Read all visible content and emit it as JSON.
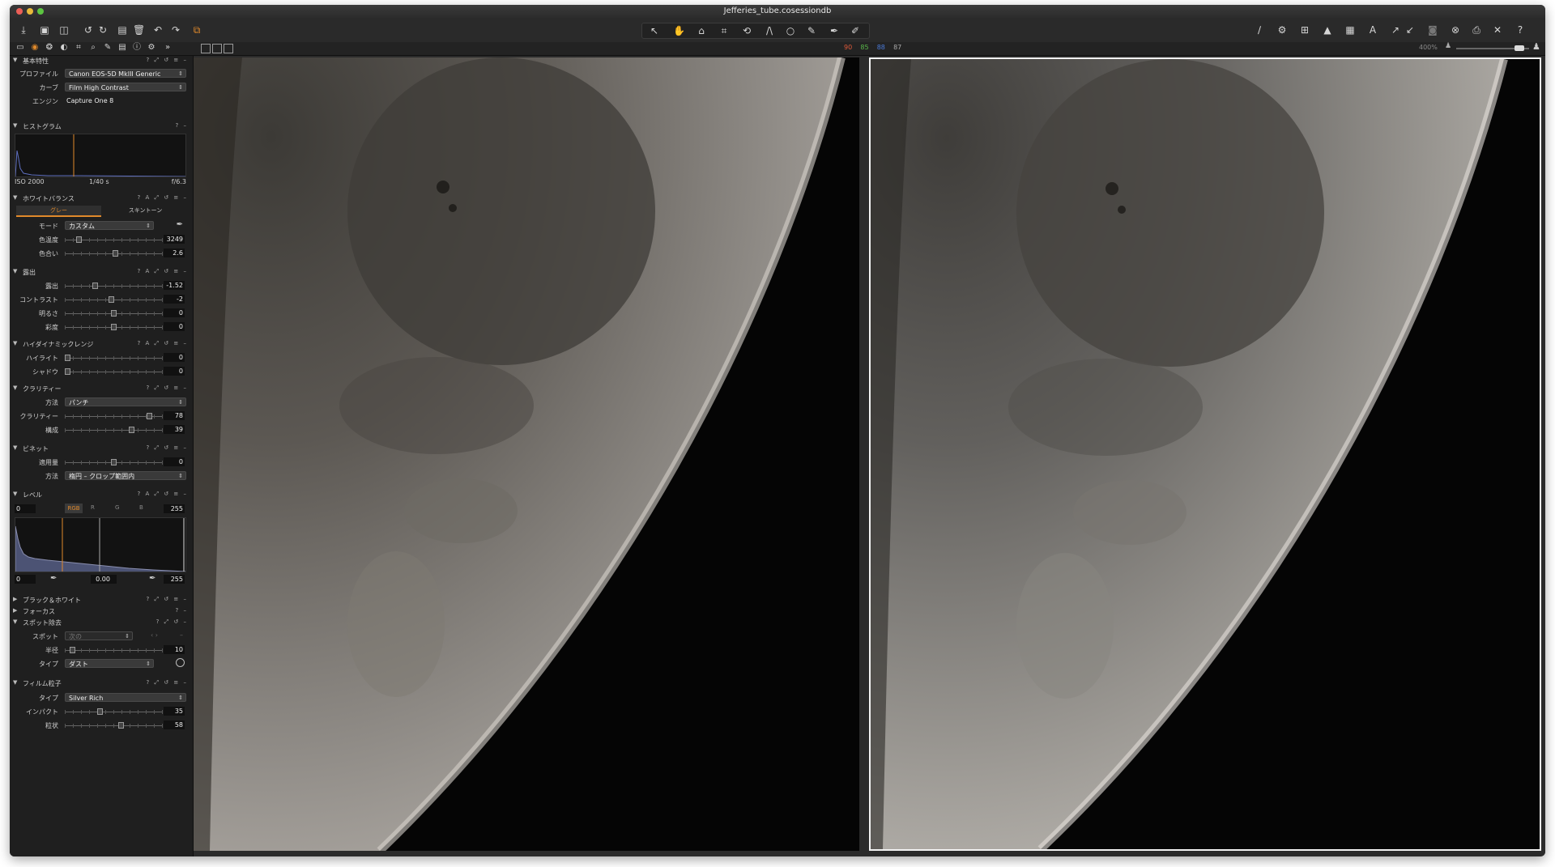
{
  "window": {
    "title": "Jefferies_tube.cosessiondb"
  },
  "colors": {
    "accent": "#e0892b",
    "panel_bg": "#1f1f1f",
    "view_bg": "#050505"
  },
  "subbar": {
    "readout": {
      "r": "90",
      "g": "85",
      "b": "88",
      "l": "87"
    },
    "zoom": "400%"
  },
  "panel": {
    "basic": {
      "title": "基本特性",
      "profile_label": "プロファイル",
      "profile_value": "Canon EOS-5D MkIII Generic",
      "curve_label": "カーブ",
      "curve_value": "Film High Contrast",
      "engine_label": "エンジン",
      "engine_value": "Capture One 8"
    },
    "histogram": {
      "title": "ヒストグラム",
      "iso": "ISO 2000",
      "shutter": "1/40 s",
      "aperture": "f/6.3"
    },
    "white_balance": {
      "title": "ホワイトバランス",
      "tab_gray": "グレー",
      "tab_skin": "スキントーン",
      "mode_label": "モード",
      "mode_value": "カスタム",
      "kelvin_label": "色温度",
      "kelvin_value": "3249",
      "tint_label": "色合い",
      "tint_value": "2.6",
      "kelvin_pos": 0.12,
      "tint_pos": 0.52
    },
    "exposure": {
      "title": "露出",
      "exposure_label": "露出",
      "exposure_value": "-1.52",
      "contrast_label": "コントラスト",
      "contrast_value": "-2",
      "brightness_label": "明るさ",
      "brightness_value": "0",
      "saturation_label": "彩度",
      "saturation_value": "0",
      "exposure_pos": 0.3,
      "contrast_pos": 0.48,
      "brightness_pos": 0.5,
      "saturation_pos": 0.5
    },
    "hdr": {
      "title": "ハイダイナミックレンジ",
      "highlight_label": "ハイライト",
      "highlight_value": "0",
      "shadow_label": "シャドウ",
      "shadow_value": "0",
      "highlight_pos": 0.0,
      "shadow_pos": 0.0
    },
    "clarity": {
      "title": "クラリティー",
      "method_label": "方法",
      "method_value": "パンチ",
      "clarity_label": "クラリティー",
      "clarity_value": "78",
      "structure_label": "構成",
      "structure_value": "39",
      "clarity_pos": 0.89,
      "structure_pos": 0.7
    },
    "vignette": {
      "title": "ビネット",
      "amount_label": "適用量",
      "amount_value": "0",
      "method_label": "方法",
      "method_value": "楕円 – クロップ範囲内",
      "amount_pos": 0.5
    },
    "levels": {
      "title": "レベル",
      "left_value": "0",
      "right_value": "255",
      "channel_rgb": "RGB",
      "ch_r": "R",
      "ch_g": "G",
      "ch_b": "B",
      "out_left": "0",
      "mid_value": "0.00",
      "out_right": "255"
    },
    "bw": {
      "title": "ブラック＆ホワイト"
    },
    "focus": {
      "title": "フォーカス"
    },
    "spot": {
      "title": "スポット除去",
      "spot_label": "スポット",
      "spot_value": "次の",
      "radius_label": "半径",
      "radius_value": "10",
      "type_label": "タイプ",
      "type_value": "ダスト",
      "radius_pos": 0.05
    },
    "grain": {
      "title": "フィルム粒子",
      "type_label": "タイプ",
      "type_value": "Silver Rich",
      "impact_label": "インパクト",
      "impact_value": "35",
      "granularity_label": "粒状",
      "granularity_value": "58",
      "impact_pos": 0.35,
      "granularity_pos": 0.58
    }
  }
}
